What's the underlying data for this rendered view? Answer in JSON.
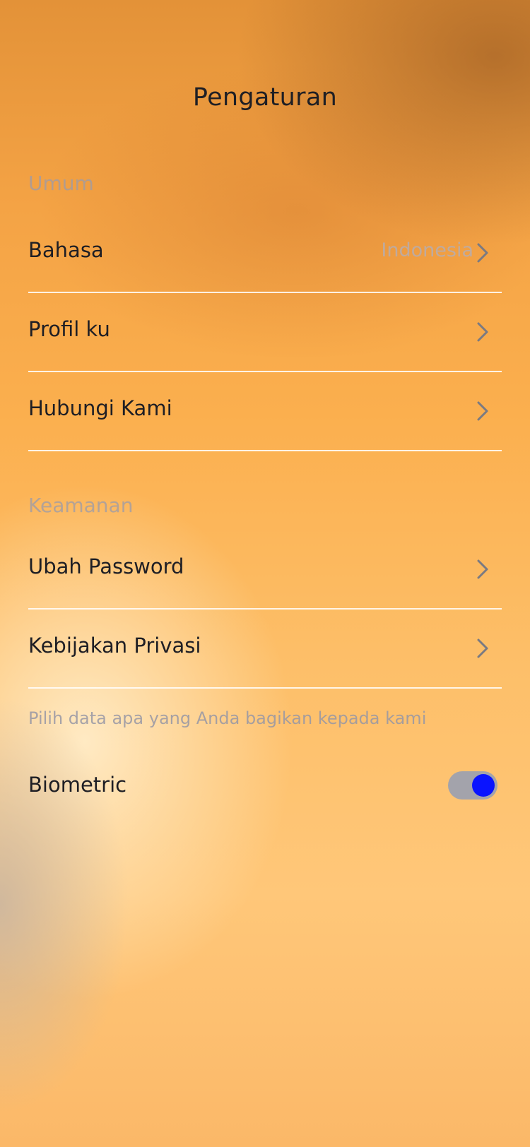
{
  "header": {
    "title": "Pengaturan"
  },
  "sections": {
    "general": {
      "label": "Umum",
      "items": {
        "language": {
          "label": "Bahasa",
          "value": "Indonesia"
        },
        "profile": {
          "label": "Profil ku"
        },
        "contact": {
          "label": "Hubungi Kami"
        }
      }
    },
    "security": {
      "label": "Keamanan",
      "items": {
        "password": {
          "label": "Ubah Password"
        },
        "privacy": {
          "label": "Kebijakan Privasi"
        }
      },
      "note": "Pilih data apa yang Anda bagikan kepada kami",
      "biometric": {
        "label": "Biometric",
        "enabled": true
      }
    }
  },
  "colors": {
    "toggle_track": "#a3a3ab",
    "toggle_knob": "#0a14ff",
    "text_primary": "#1e1e24",
    "chevron": "#7a7a82"
  },
  "icons": {
    "row_chevron": "chevron-right-icon"
  }
}
